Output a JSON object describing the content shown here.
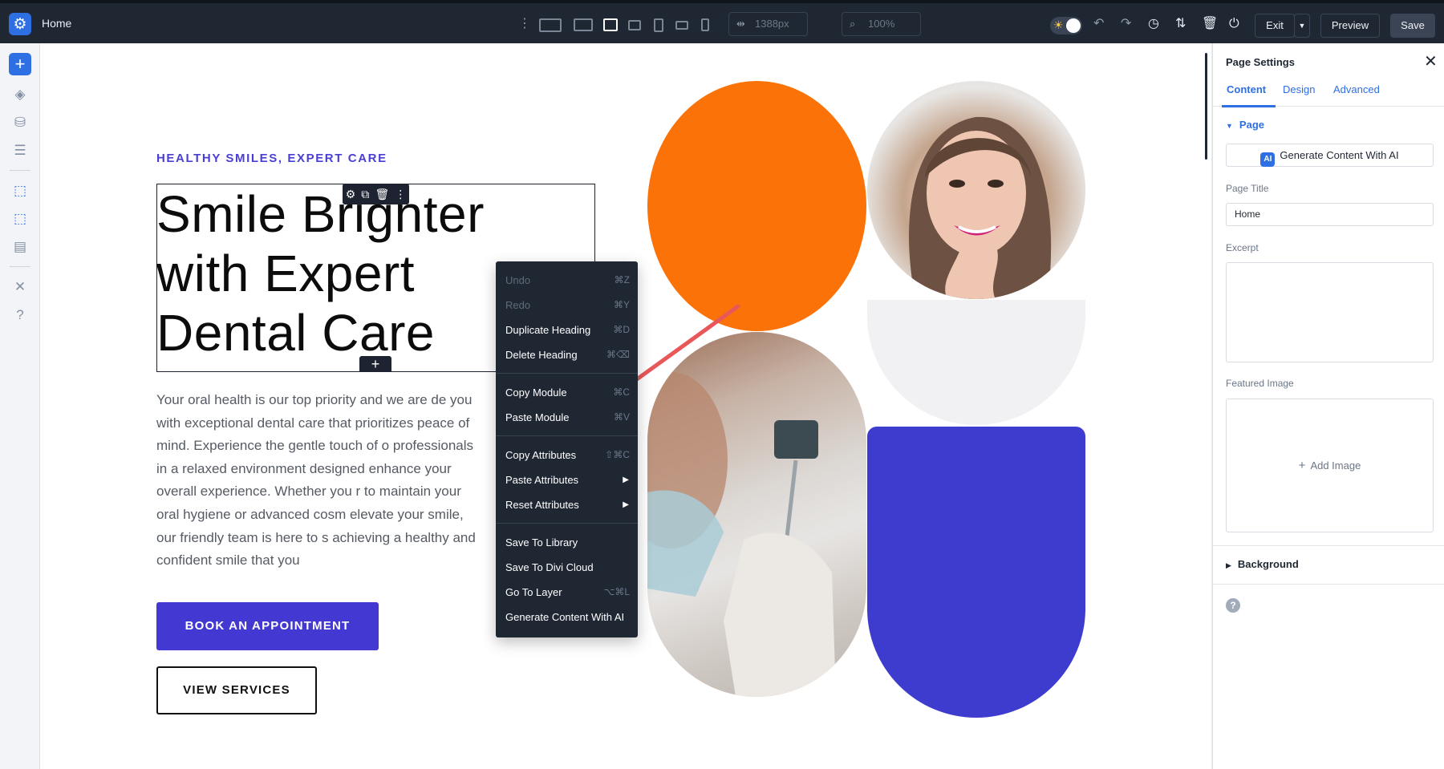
{
  "topbar": {
    "page_name": "Home",
    "width_value": "1388px",
    "zoom_value": "100%",
    "exit_label": "Exit",
    "preview_label": "Preview",
    "save_label": "Save"
  },
  "canvas": {
    "eyebrow": "HEALTHY SMILES, EXPERT CARE",
    "heading": "Smile Brighter\nwith Expert\nDental Care",
    "paragraph": "Your oral health is our top priority and we are de you with exceptional dental care that prioritizes peace of mind. Experience the gentle touch of o professionals in a relaxed environment designed enhance your overall experience. Whether you r to maintain your oral hygiene or advanced cosm elevate your smile, our friendly team is here to s achieving a healthy and confident smile that you",
    "book_button": "BOOK AN APPOINTMENT",
    "view_button": "VIEW SERVICES"
  },
  "context_menu": {
    "items": [
      {
        "label": "Undo",
        "shortcut": "⌘Z",
        "disabled": true
      },
      {
        "label": "Redo",
        "shortcut": "⌘Y",
        "disabled": true
      },
      {
        "label": "Duplicate Heading",
        "shortcut": "⌘D"
      },
      {
        "label": "Delete Heading",
        "shortcut": "⌘⌫"
      },
      {
        "label": "Copy Module",
        "shortcut": "⌘C"
      },
      {
        "label": "Paste Module",
        "shortcut": "⌘V"
      },
      {
        "label": "Copy Attributes",
        "shortcut": "⇧⌘C"
      },
      {
        "label": "Paste Attributes",
        "submenu": true
      },
      {
        "label": "Reset Attributes",
        "submenu": true
      },
      {
        "label": "Save To Library"
      },
      {
        "label": "Save To Divi Cloud"
      },
      {
        "label": "Go To Layer",
        "shortcut": "⌥⌘L"
      },
      {
        "label": "Generate Content With AI"
      }
    ]
  },
  "panel": {
    "title": "Page Settings",
    "tabs": [
      "Content",
      "Design",
      "Advanced"
    ],
    "section_page": "Page",
    "ai_button": "Generate Content With AI",
    "ai_badge": "AI",
    "page_title_label": "Page Title",
    "page_title_value": "Home",
    "excerpt_label": "Excerpt",
    "featured_image_label": "Featured Image",
    "add_image": "Add Image",
    "section_background": "Background"
  },
  "colors": {
    "accent": "#2f6fe4",
    "brand_purple": "#4338d2",
    "orange": "#fb7209",
    "annotation_arrow": "#e8575a"
  }
}
